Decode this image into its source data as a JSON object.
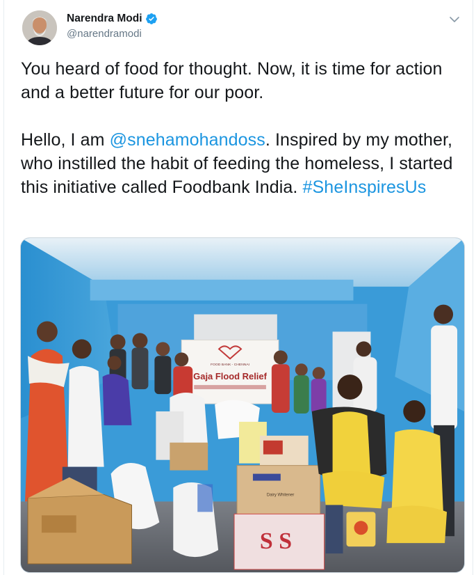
{
  "tweet": {
    "author_name": "Narendra Modi",
    "author_handle": "@narendramodi",
    "paragraph1": "You heard of food for thought. Now, it is time for action and a better future for our poor.",
    "paragraph2_prefix": "Hello, I am ",
    "mention": "@snehamohandoss",
    "paragraph2_mid": ". Inspired by my mother, who instilled the habit of feeding the homeless,  I started this initiative called Foodbank India. ",
    "hashtag": "#SheInspiresUs"
  },
  "media": {
    "banner_title": "Gaja Flood Relief",
    "banner_org": "FOOD BANK - CHENNAI",
    "box_label_ss": "S S",
    "box_label_dairy": "Dairy Whitener"
  },
  "colors": {
    "link": "#1b95e0",
    "verified": "#1da1f2",
    "text": "#14171a",
    "muted": "#657786"
  },
  "icons": {
    "verified": "verified-badge-icon",
    "caret": "chevron-down-icon"
  }
}
